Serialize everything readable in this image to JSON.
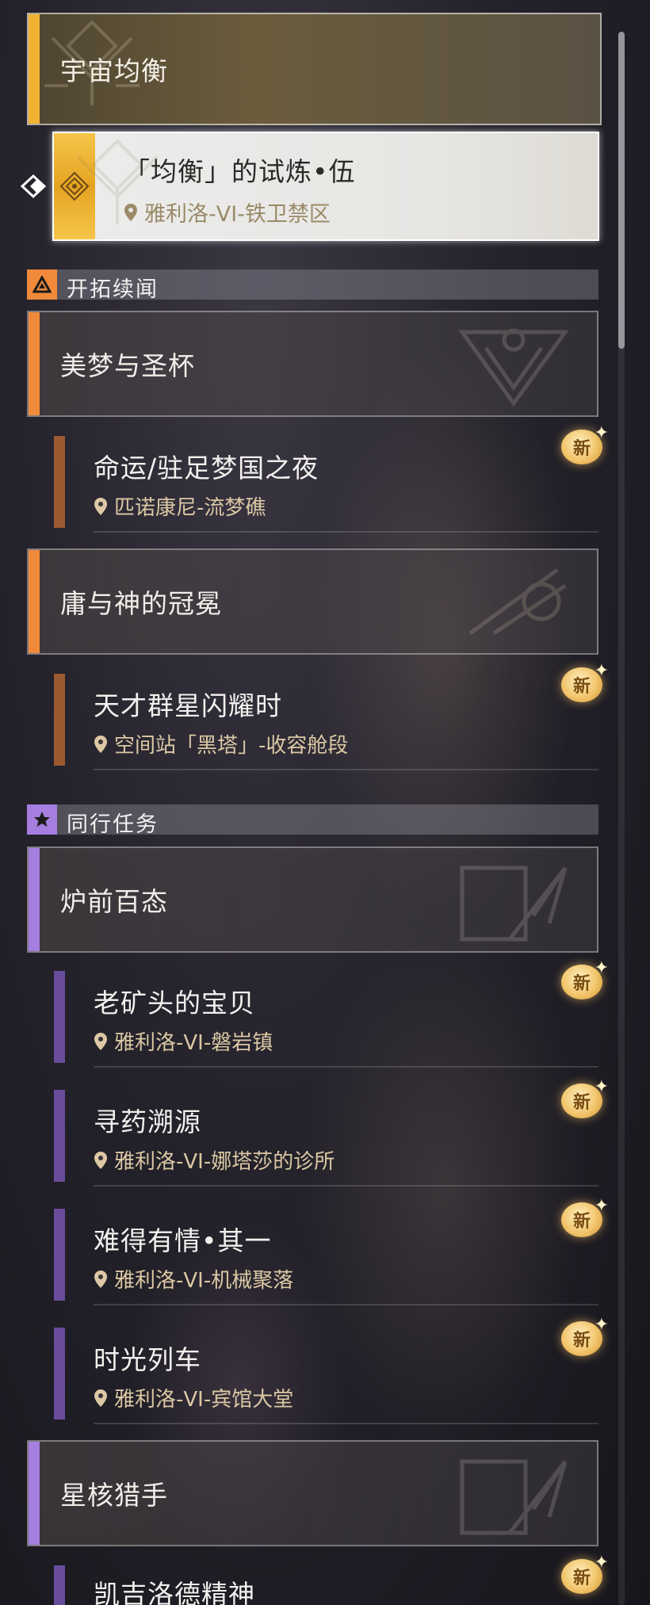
{
  "top": {
    "chapter_title": "宇宙均衡",
    "selected_quest": {
      "name": "「均衡」的试炼•伍",
      "location": "雅利洛-VI-铁卫禁区"
    }
  },
  "sections": [
    {
      "title": "开拓续闻",
      "icon": "trailblaze-icon",
      "accent": "#f08a3a",
      "chapters": [
        {
          "title": "美梦与圣杯",
          "quests": [
            {
              "name": "命运/驻足梦国之夜",
              "location": "匹诺康尼-流梦礁",
              "badge": "新"
            }
          ]
        },
        {
          "title": "庸与神的冠冕",
          "quests": [
            {
              "name": "天才群星闪耀时",
              "location": "空间站「黑塔」-收容舱段",
              "badge": "新"
            }
          ]
        }
      ]
    },
    {
      "title": "同行任务",
      "icon": "companion-star-icon",
      "accent": "#a57ee0",
      "chapters": [
        {
          "title": "炉前百态",
          "quests": [
            {
              "name": "老矿头的宝贝",
              "location": "雅利洛-VI-磐岩镇",
              "badge": "新"
            },
            {
              "name": "寻药溯源",
              "location": "雅利洛-VI-娜塔莎的诊所",
              "badge": "新"
            },
            {
              "name": "难得有情•其一",
              "location": "雅利洛-VI-机械聚落",
              "badge": "新"
            },
            {
              "name": "时光列车",
              "location": "雅利洛-VI-宾馆大堂",
              "badge": "新"
            }
          ]
        },
        {
          "title": "星核猎手",
          "quests": [
            {
              "name": "凯吉洛德精神",
              "location": "",
              "badge": "新"
            }
          ]
        }
      ]
    }
  ]
}
